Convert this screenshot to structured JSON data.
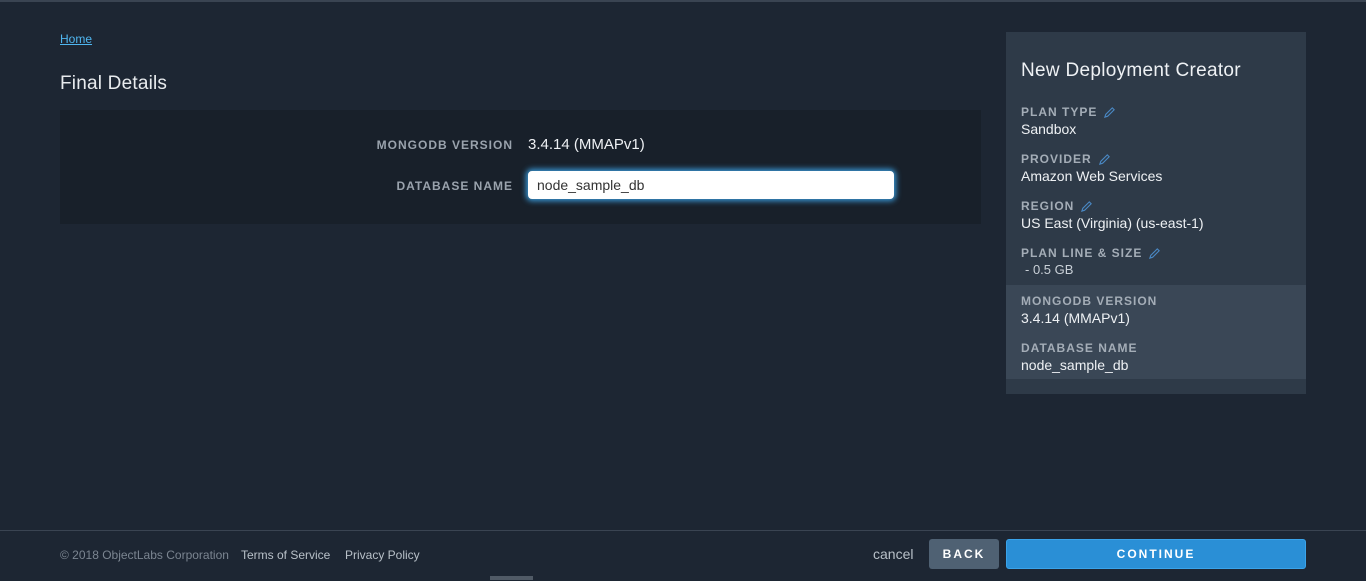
{
  "breadcrumb": {
    "home": "Home"
  },
  "page": {
    "title": "Final Details"
  },
  "form": {
    "mongodb_version_label": "MONGODB VERSION",
    "mongodb_version_value": "3.4.14 (MMAPv1)",
    "database_name_label": "DATABASE NAME",
    "database_name_value": "node_sample_db"
  },
  "summary": {
    "title": "New Deployment Creator",
    "items": [
      {
        "label": "PLAN TYPE",
        "value": "Sandbox",
        "editable": true
      },
      {
        "label": "PROVIDER",
        "value": "Amazon Web Services",
        "editable": true
      },
      {
        "label": "REGION",
        "value": "US East (Virginia) (us-east-1)",
        "editable": true
      },
      {
        "label": "PLAN LINE & SIZE",
        "value": " - 0.5 GB",
        "editable": true
      },
      {
        "label": "MONGODB VERSION",
        "value": "3.4.14 (MMAPv1)",
        "editable": false
      },
      {
        "label": "DATABASE NAME",
        "value": "node_sample_db",
        "editable": false
      }
    ]
  },
  "footer": {
    "copyright": "© 2018 ObjectLabs Corporation",
    "terms": "Terms of Service",
    "privacy": "Privacy Policy",
    "cancel": "cancel",
    "back": "BACK",
    "continue": "CONTINUE"
  },
  "colors": {
    "background": "#1d2633",
    "panel": "#18202a",
    "summary_panel": "#2e3a48",
    "summary_highlight": "#3a4756",
    "accent": "#2a8fd6",
    "link": "#4fb6f0",
    "back_button": "#4f6173"
  },
  "icons": {
    "edit": "pencil-icon"
  }
}
